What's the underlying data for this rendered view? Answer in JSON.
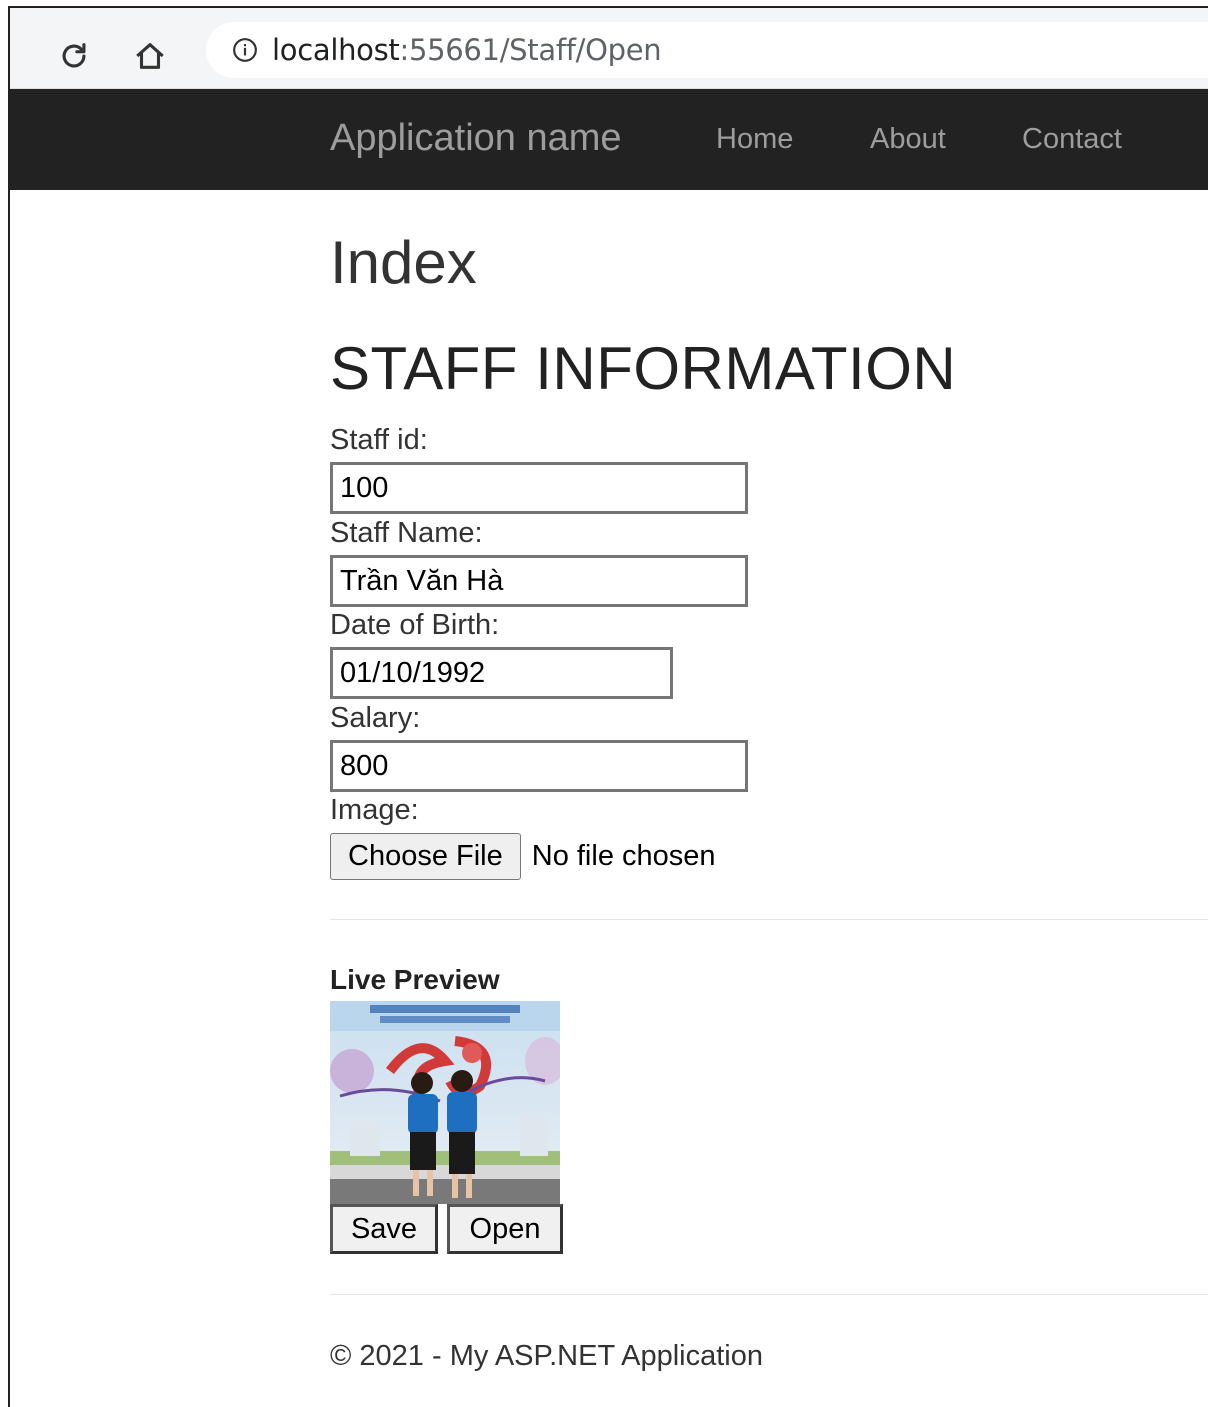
{
  "browser": {
    "url_host": "localhost",
    "url_port_path": ":55661/Staff/Open"
  },
  "navbar": {
    "brand": "Application name",
    "links": [
      "Home",
      "About",
      "Contact"
    ]
  },
  "page": {
    "title": "Index",
    "section_title": "STAFF INFORMATION"
  },
  "form": {
    "staff_id_label": "Staff id:",
    "staff_id_value": "100",
    "staff_name_label": "Staff Name:",
    "staff_name_value": "Trần Văn Hà",
    "dob_label": "Date of Birth:",
    "dob_value": "01/10/1992",
    "salary_label": "Salary:",
    "salary_value": "800",
    "image_label": "Image:",
    "choose_file_label": "Choose File",
    "file_status": "No file chosen"
  },
  "preview": {
    "title": "Live Preview"
  },
  "actions": {
    "save_label": "Save",
    "open_label": "Open"
  },
  "footer": {
    "text": "© 2021 - My ASP.NET Application"
  },
  "colors": {
    "navbar_bg": "#222222",
    "navbar_text": "#9d9d9d",
    "preview_shirt": "#1e6fc0"
  }
}
